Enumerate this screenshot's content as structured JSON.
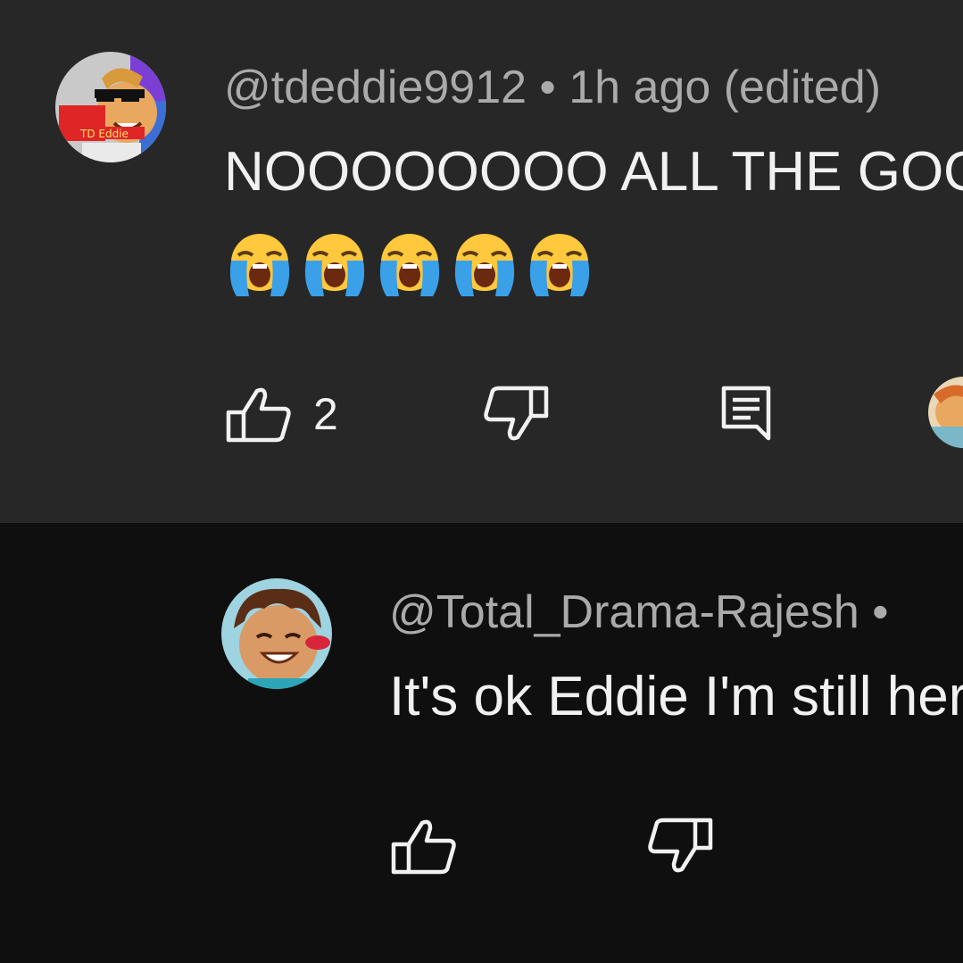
{
  "comment": {
    "author": "@tdeddie9912",
    "separator": "•",
    "time": "1h ago (edited)",
    "text": "NOOOOOOOO ALL THE GOOD ONES",
    "emojis": [
      "loudly-crying-face",
      "loudly-crying-face",
      "loudly-crying-face",
      "loudly-crying-face",
      "loudly-crying-face"
    ],
    "avatar_text": "TD Eddie",
    "like_count": "2",
    "icons": {
      "like": "thumbs-up-icon",
      "dislike": "thumbs-down-icon",
      "reply": "reply-comment-icon"
    }
  },
  "reply": {
    "author": "@Total_Drama-Rajesh",
    "separator": "•",
    "text": "It's ok Eddie I'm still here",
    "icons": {
      "like": "thumbs-up-icon",
      "dislike": "thumbs-down-icon"
    }
  },
  "colors": {
    "top_background": "#272727",
    "reply_background": "#0f0f0f",
    "meta_text": "#aaaaaa",
    "primary_text": "#f1f1f1"
  }
}
